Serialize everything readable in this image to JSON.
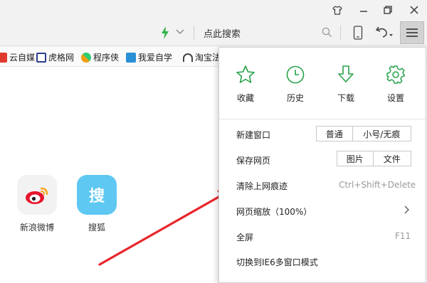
{
  "toolbar": {
    "search_placeholder": "点此搜索"
  },
  "bookmarks": [
    {
      "label": "云自媒",
      "color": "#e03a2f"
    },
    {
      "label": "虎格网",
      "color": "#c0392b"
    },
    {
      "label": "程序侠",
      "color": "#f39c12"
    },
    {
      "label": "我爱自学",
      "color": "#2b8fd6"
    },
    {
      "label": "淘宝法",
      "color": "#444444"
    }
  ],
  "apps": [
    {
      "label": "新浪微博",
      "icon": "weibo-icon"
    },
    {
      "label": "搜狐",
      "icon": "sohu-icon",
      "glyph": "搜"
    }
  ],
  "menu": {
    "quick_actions": [
      {
        "label": "收藏",
        "icon": "star-icon"
      },
      {
        "label": "历史",
        "icon": "clock-icon"
      },
      {
        "label": "下载",
        "icon": "download-icon"
      },
      {
        "label": "设置",
        "icon": "gear-icon"
      }
    ],
    "new_window": {
      "label": "新建窗口",
      "options": [
        "普通",
        "小号/无痕"
      ]
    },
    "save_page": {
      "label": "保存网页",
      "options": [
        "图片",
        "文件"
      ]
    },
    "clear_history": {
      "label": "清除上网痕迹",
      "shortcut": "Ctrl+Shift+Delete"
    },
    "zoom": {
      "label": "网页缩放（100%）"
    },
    "fullscreen": {
      "label": "全屏",
      "shortcut": "F11"
    },
    "ie6_mode": {
      "label": "切换到IE6多窗口模式"
    }
  },
  "colors": {
    "accent_green": "#27a24a",
    "arrow_red": "#e8242b",
    "bolt_green": "#2fb34a"
  }
}
